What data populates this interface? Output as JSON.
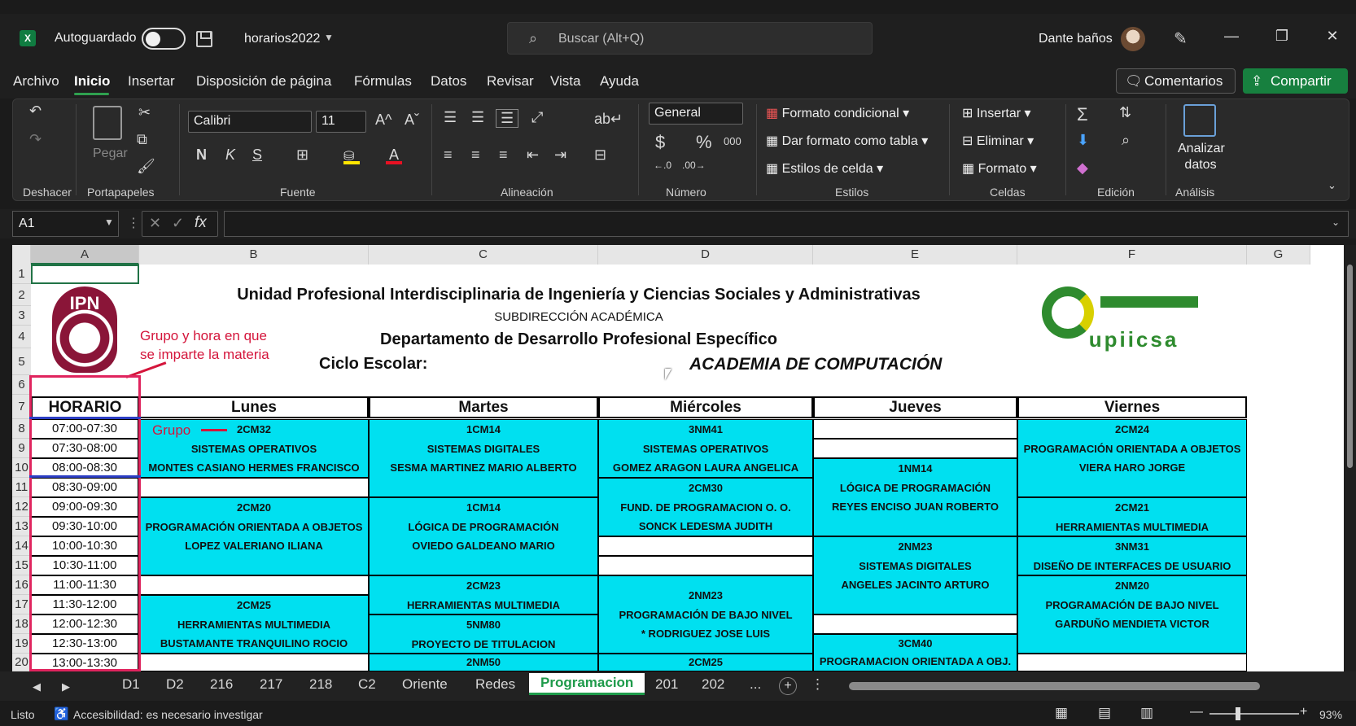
{
  "titlebar": {
    "app_icon": "excel-icon",
    "autosave_label": "Autoguardado",
    "filename": "horarios2022",
    "search_placeholder": "Buscar (Alt+Q)",
    "user_name": "Dante baños"
  },
  "menu": {
    "items": [
      "Archivo",
      "Inicio",
      "Insertar",
      "Disposición de página",
      "Fórmulas",
      "Datos",
      "Revisar",
      "Vista",
      "Ayuda"
    ],
    "active": "Inicio",
    "comentarios": "Comentarios",
    "compartir": "Compartir"
  },
  "ribbon": {
    "deshacer": "Deshacer",
    "pegar": "Pegar",
    "portapapeles": "Portapapeles",
    "font_name": "Calibri",
    "font_size": "11",
    "fuente": "Fuente",
    "bold": "N",
    "italic": "K",
    "underline": "S",
    "alineacion": "Alineación",
    "number_format": "General",
    "numero": "Número",
    "formato_condicional": "Formato condicional",
    "dar_formato_tabla": "Dar formato como tabla",
    "estilos_celda": "Estilos de celda",
    "estilos": "Estilos",
    "insertar": "Insertar",
    "eliminar": "Eliminar",
    "formato": "Formato",
    "celdas": "Celdas",
    "edicion": "Edición",
    "analizar": "Analizar",
    "datos": "datos",
    "analisis": "Análisis"
  },
  "formula_bar": {
    "namebox": "A1",
    "fx": "fx",
    "value": ""
  },
  "columns": [
    "A",
    "B",
    "C",
    "D",
    "E",
    "F",
    "G"
  ],
  "rows": [
    "1",
    "2",
    "3",
    "4",
    "5",
    "6",
    "7",
    "8",
    "9",
    "10",
    "11",
    "12",
    "13",
    "14",
    "15",
    "16",
    "17",
    "18",
    "19",
    "20"
  ],
  "header": {
    "title": "Unidad Profesional Interdisciplinaria de Ingeniería y Ciencias  Sociales y Administrativas",
    "subdir": "SUBDIRECCIÓN ACADÉMICA",
    "depto": "Departamento de Desarrollo Profesional Específico",
    "ciclo": "Ciclo Escolar:",
    "academia": "ACADEMIA DE COMPUTACIÓN",
    "logo_left": "IPN",
    "logo_right": "upiicsa"
  },
  "schedule": {
    "horario_label": "HORARIO",
    "days": [
      "Lunes",
      "Martes",
      "Miércoles",
      "Jueves",
      "Viernes"
    ],
    "times": [
      "07:00-07:30",
      "07:30-08:00",
      "08:00-08:30",
      "08:30-09:00",
      "09:00-09:30",
      "09:30-10:00",
      "10:00-10:30",
      "10:30-11:00",
      "11:00-11:30",
      "11:30-12:00",
      "12:00-12:30",
      "12:30-13:00",
      "13:00-13:30"
    ],
    "lunes": [
      [
        "2CM32",
        "SISTEMAS OPERATIVOS",
        "MONTES CASIANO HERMES FRANCISCO"
      ],
      [
        "2CM20",
        "PROGRAMACIÓN ORIENTADA A OBJETOS",
        "LOPEZ VALERIANO ILIANA"
      ],
      [
        "2CM25",
        "HERRAMIENTAS MULTIMEDIA",
        "BUSTAMANTE TRANQUILINO ROCIO"
      ]
    ],
    "martes": [
      [
        "1CM14",
        "SISTEMAS DIGITALES",
        "SESMA MARTINEZ MARIO ALBERTO"
      ],
      [
        "1CM14",
        "LÓGICA DE PROGRAMACIÓN",
        "OVIEDO GALDEANO MARIO"
      ],
      [
        "2CM23",
        "HERRAMIENTAS MULTIMEDIA"
      ],
      [
        "5NM80",
        "PROYECTO DE TITULACION"
      ],
      [
        "2NM50"
      ]
    ],
    "miercoles": [
      [
        "3NM41",
        "SISTEMAS OPERATIVOS",
        "GOMEZ ARAGON LAURA ANGELICA"
      ],
      [
        "2CM30",
        "FUND. DE PROGRAMACION O. O.",
        "SONCK LEDESMA JUDITH"
      ],
      [
        "2NM23",
        "PROGRAMACIÓN DE BAJO NIVEL",
        "* RODRIGUEZ JOSE LUIS"
      ],
      [
        "2CM25"
      ]
    ],
    "jueves": [
      [
        "1NM14",
        "LÓGICA DE PROGRAMACIÓN",
        "REYES ENCISO JUAN ROBERTO"
      ],
      [
        "2NM23",
        "SISTEMAS DIGITALES",
        "ANGELES JACINTO ARTURO"
      ],
      [
        "3CM40",
        "PROGRAMACION ORIENTADA A OBJ."
      ]
    ],
    "viernes": [
      [
        "2CM24",
        "PROGRAMACIÓN ORIENTADA A OBJETOS",
        "VIERA HARO JORGE"
      ],
      [
        "2CM21",
        "HERRAMIENTAS MULTIMEDIA"
      ],
      [
        "3NM31",
        "DISEÑO DE INTERFACES DE USUARIO"
      ],
      [
        "2NM20",
        "PROGRAMACIÓN DE BAJO NIVEL",
        "GARDUÑO MENDIETA VICTOR"
      ]
    ]
  },
  "annotations": {
    "grupo_hora_1": "Grupo y hora en que",
    "grupo_hora_2": "se imparte la materia",
    "grupo": "Grupo"
  },
  "sheet_tabs": [
    "D1",
    "D2",
    "216",
    "217",
    "218",
    "C2",
    "Oriente",
    "Redes",
    "Programacion",
    "201",
    "202",
    "..."
  ],
  "active_sheet": "Programacion",
  "status": {
    "ready": "Listo",
    "accessibility": "Accesibilidad: es necesario investigar",
    "zoom": "93%"
  },
  "colors": {
    "accent": "#107c41",
    "cell_fill": "#00e0f0",
    "annotation": "#d4153b"
  }
}
